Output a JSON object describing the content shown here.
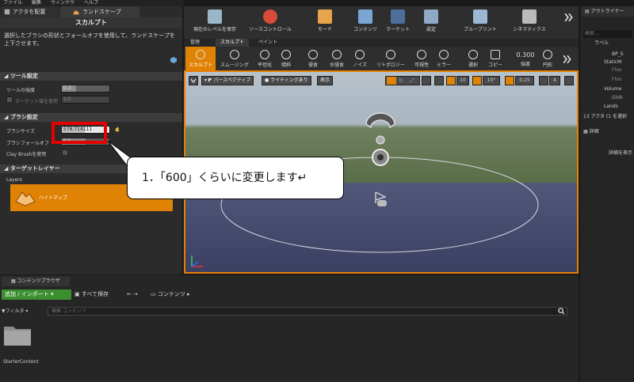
{
  "menu": [
    "ファイル",
    "編集",
    "ウィンドウ",
    "ヘルプ"
  ],
  "left_tabs": {
    "place_actors": "アクタを配置",
    "landscape": "ランドスケープ"
  },
  "sculpt_header": "スカルプト",
  "description": "選択したブラシの形状とフォールオフを使用して、ランドスケープを上下させます。",
  "tool_settings": {
    "title": "ツール設定",
    "strength_label": "ツールの強度",
    "strength_value": "0.3",
    "target_label": "ターゲット値を使用",
    "target_value": "1.0"
  },
  "brush_settings": {
    "title": "ブラシ設定",
    "size_label": "ブラシサイズ",
    "size_value": "578.714111",
    "size_fill": 0.48,
    "falloff_label": "ブラシフォールオフ",
    "falloff_value": "0.5",
    "falloff_fill": 0.5,
    "claybrush_label": "Clay Brushを使用"
  },
  "target_layers": {
    "title": "ターゲットレイヤー",
    "layers_label": "Layers",
    "layer_name": "ハイトマップ"
  },
  "toolbar": {
    "save": "現在のレベルを保存",
    "source": "ソースコントロール",
    "mode": "モード",
    "content": "コンテンツ",
    "market": "マーケット",
    "settings": "設定",
    "blueprint": "ブループリント",
    "cinematics": "シネマティクス"
  },
  "mode_tabs": [
    "管理",
    "スカルプト",
    "ペイント"
  ],
  "mode_tools": [
    "スカルプト",
    "スムージング",
    "平坦化",
    "傾斜",
    "侵食",
    "水侵食",
    "ノイズ",
    "リトポロジー",
    "可視性",
    "ミラー",
    "選択",
    "コピー"
  ],
  "strength": {
    "value": "0.300",
    "label": "強度",
    "shape": "円形"
  },
  "viewport": {
    "perspective": "パースペクティブ",
    "lighting": "ライティングあり",
    "show": "表示",
    "grid": "10",
    "angle": "10°",
    "scale": "0.25",
    "speed": "4"
  },
  "callout": "1．「600」くらいに変更します↵",
  "outliner": {
    "title": "アウトライナー",
    "search": "検索...",
    "label": "ラベル",
    "items": [
      "BP_S",
      "StaticM",
      "Floo",
      "Floo",
      "Volume",
      "Glob",
      "Lands"
    ],
    "count": "13 アクタ (1 を選択"
  },
  "details": {
    "title": "詳細",
    "hint": "詳細を表示"
  },
  "content_browser": {
    "tab": "コンテンツブラウザ",
    "add": "追加 / インポート",
    "save_all": "すべて保存",
    "path": "コンテンツ",
    "filter": "フィルタ",
    "search_placeholder": "検索 コンテンツ",
    "folder": "StarterContent"
  },
  "colors": {
    "accent": "#e87e04",
    "highlight": "#e60000",
    "green_button": "#3b8f2f"
  }
}
